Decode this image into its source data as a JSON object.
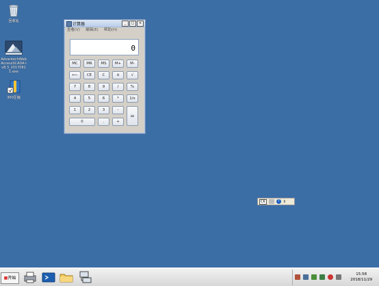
{
  "desktop": {
    "icons": [
      {
        "label": "回收站",
        "icon": "recycle-bin-icon"
      },
      {
        "label": "AdvantechWebAccessSCADA-Iv8.3_20170811.exe",
        "icon": "installer-icon"
      },
      {
        "label": "360压缩",
        "icon": "archive-icon"
      }
    ]
  },
  "calculator": {
    "title": "计算器",
    "menu": [
      "查看(V)",
      "编辑(E)",
      "帮助(H)"
    ],
    "display_value": "0",
    "keys": {
      "mc": "MC",
      "mr": "MR",
      "ms": "MS",
      "mplus": "M+",
      "mminus": "M-",
      "back": "⟵",
      "ce": "CE",
      "c": "C",
      "sign": "±",
      "sqrt": "√",
      "n7": "7",
      "n8": "8",
      "n9": "9",
      "div": "/",
      "pct": "%",
      "n4": "4",
      "n5": "5",
      "n6": "6",
      "mul": "*",
      "inv": "1/x",
      "n1": "1",
      "n2": "2",
      "n3": "3",
      "sub": "-",
      "eq": "=",
      "n0": "0",
      "dot": ".",
      "add": "+"
    }
  },
  "floating_toolbar": {
    "ck_label": "CK",
    "help_label": "?"
  },
  "taskbar": {
    "start_label": "开始",
    "items": [
      "printer-icon",
      "powershell-icon",
      "folder-icon",
      "network-icon"
    ],
    "clock_time": "15:58",
    "clock_date": "2018/11/29"
  },
  "colors": {
    "desktop": "#3c6ea6",
    "window": "#d4d0c8"
  }
}
